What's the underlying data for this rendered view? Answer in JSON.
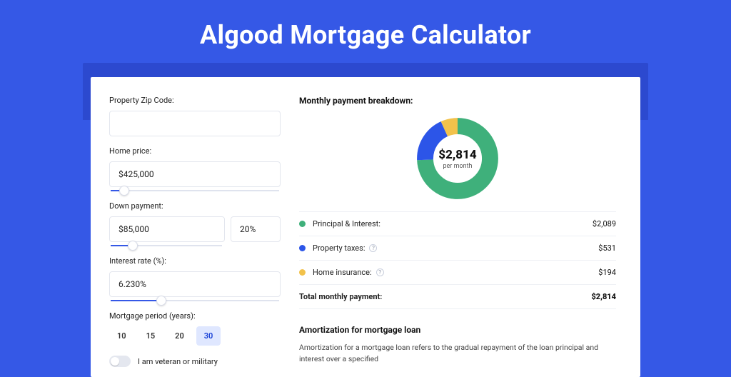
{
  "hero": {
    "title": "Algood Mortgage Calculator"
  },
  "form": {
    "zip": {
      "label": "Property Zip Code:",
      "value": ""
    },
    "price": {
      "label": "Home price:",
      "value": "$425,000",
      "slider_pct": 8
    },
    "down": {
      "label": "Down payment:",
      "value": "$85,000",
      "pct": "20%",
      "slider_pct": 20
    },
    "rate": {
      "label": "Interest rate (%):",
      "value": "6.230%",
      "slider_pct": 30
    },
    "period": {
      "label": "Mortgage period (years):",
      "options": [
        "10",
        "15",
        "20",
        "30"
      ],
      "selected": "30"
    },
    "veteran": {
      "label": "I am veteran or military",
      "on": false
    }
  },
  "breakdown": {
    "title": "Monthly payment breakdown:",
    "total_value": "$2,814",
    "total_caption": "per month",
    "items": [
      {
        "key": "pi",
        "label": "Principal & Interest:",
        "value": "$2,089",
        "color": "#3fb07b",
        "info": false
      },
      {
        "key": "tax",
        "label": "Property taxes:",
        "value": "$531",
        "color": "#2c55e8",
        "info": true
      },
      {
        "key": "ins",
        "label": "Home insurance:",
        "value": "$194",
        "color": "#f2c24b",
        "info": true
      }
    ],
    "total_row": {
      "label": "Total monthly payment:",
      "value": "$2,814"
    }
  },
  "chart_data": {
    "type": "pie",
    "title": "Monthly payment breakdown:",
    "series": [
      {
        "name": "Principal & Interest",
        "value": 2089,
        "color": "#3fb07b"
      },
      {
        "name": "Property taxes",
        "value": 531,
        "color": "#2c55e8"
      },
      {
        "name": "Home insurance",
        "value": 194,
        "color": "#f2c24b"
      }
    ],
    "total": 2814,
    "inner_radius_pct": 62
  },
  "amort": {
    "title": "Amortization for mortgage loan",
    "body": "Amortization for a mortgage loan refers to the gradual repayment of the loan principal and interest over a specified"
  }
}
